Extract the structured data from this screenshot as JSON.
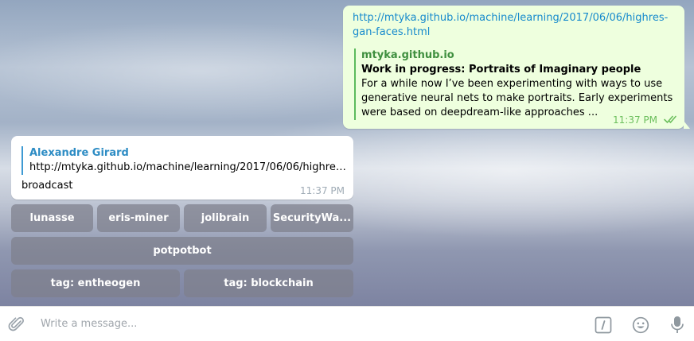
{
  "outgoing_message": {
    "link": "http://mtyka.github.io/machine/learning/2017/06/06/highres-gan-faces.html",
    "preview": {
      "site": "mtyka.github.io",
      "title": "Work in progress: Portraits of Imaginary people",
      "description": "For a while now I’ve been experimenting with ways to use generative neural nets to make portraits. Early experiments were based on deepdream-like approaches ..."
    },
    "time": "11:37 PM",
    "status_icon": "double-check-icon"
  },
  "incoming_message": {
    "reply_author": "Alexandre Girard",
    "reply_text": "http://mtyka.github.io/machine/learning/2017/06/06/highres-ga...",
    "text": "broadcast",
    "time": "11:37 PM"
  },
  "keyboard": {
    "row1": [
      "lunasse",
      "eris-miner",
      "jolibrain",
      "SecurityWa..."
    ],
    "row2": [
      "potpotbot"
    ],
    "row3": [
      "tag: entheogen",
      "tag: blockchain"
    ]
  },
  "input_bar": {
    "placeholder": "Write a message...",
    "icons": [
      "attach-icon",
      "bot-command-icon",
      "emoji-icon",
      "microphone-icon"
    ]
  },
  "colors": {
    "outgoing_bubble": "#eeffde",
    "incoming_bubble": "#ffffff",
    "link": "#168acd",
    "preview_accent": "#5cbb5c",
    "reply_accent": "#3e9ad3",
    "keyboard_button": "#7e808c"
  }
}
